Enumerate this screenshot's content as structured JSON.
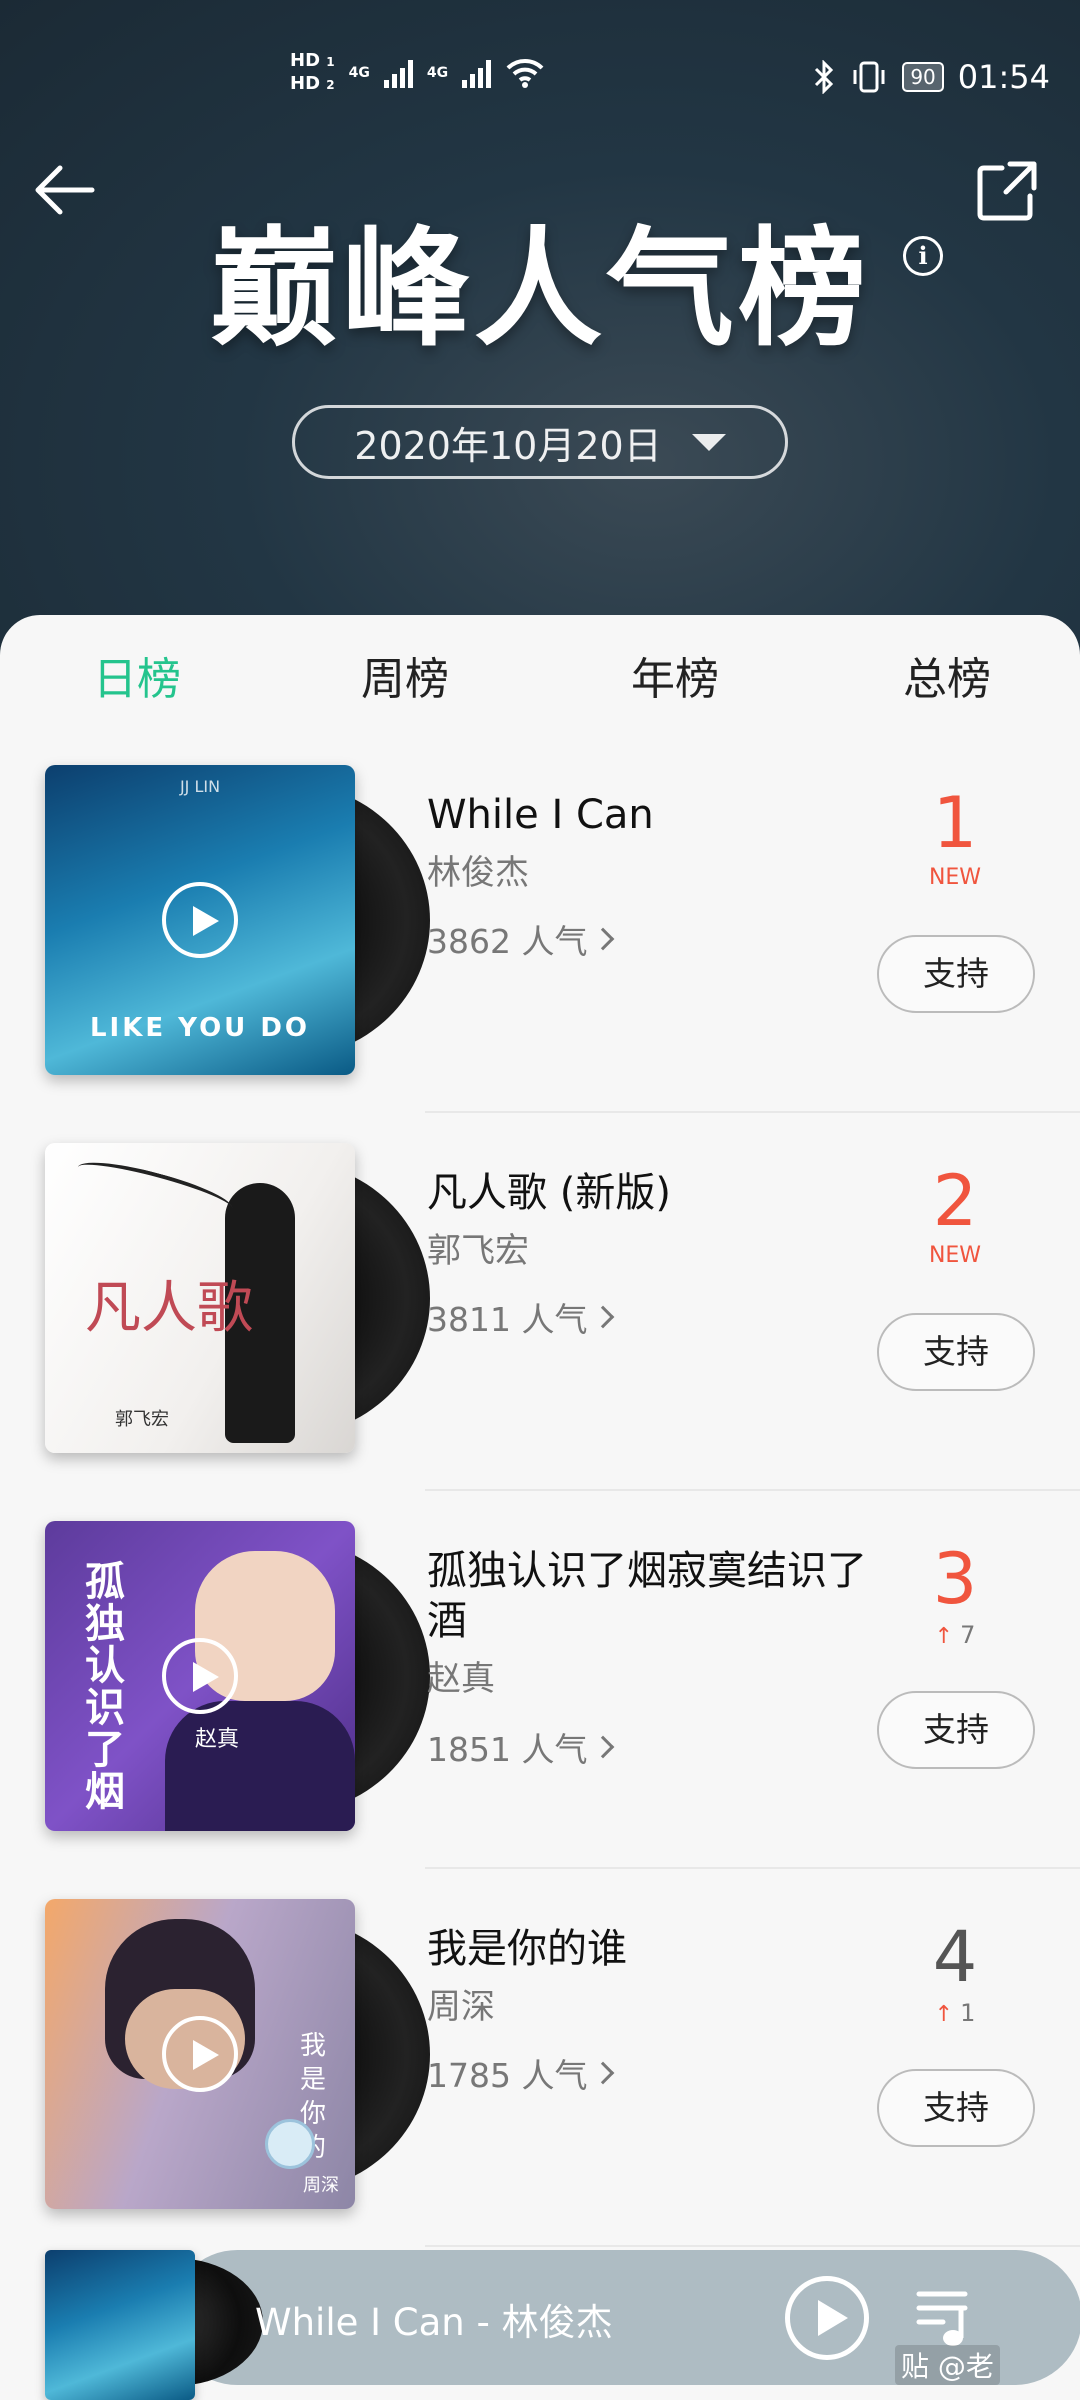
{
  "status_bar": {
    "hd1": "HD",
    "hd2": "HD",
    "sim1": "1",
    "sim2": "2",
    "net1": "4G",
    "net2": "4G",
    "battery": "90",
    "time": "01:54"
  },
  "header": {
    "title": "巅峰人气榜",
    "date": "2020年10月20日",
    "info_label": "i"
  },
  "tabs": [
    {
      "label": "日榜",
      "active": true
    },
    {
      "label": "周榜",
      "active": false
    },
    {
      "label": "年榜",
      "active": false
    },
    {
      "label": "总榜",
      "active": false
    }
  ],
  "songs": [
    {
      "title": "While I Can",
      "artist": "林俊杰",
      "popularity": "3862 人气",
      "rank": "1",
      "rank_sub": "NEW",
      "support": "支持",
      "cover_text": "LIKE YOU DO",
      "cover_top": "JJ LIN"
    },
    {
      "title": "凡人歌 (新版)",
      "artist": "郭飞宏",
      "popularity": "3811 人气",
      "rank": "2",
      "rank_sub": "NEW",
      "support": "支持",
      "cover_text": "凡人歌",
      "cover_top": "郭飞宏"
    },
    {
      "title": "孤独认识了烟寂寞结识了酒",
      "artist": "赵真",
      "popularity": "1851 人气",
      "rank": "3",
      "rank_change": "7",
      "support": "支持",
      "cover_text": "孤独认识了烟",
      "cover_top": "赵真"
    },
    {
      "title": "我是你的谁",
      "artist": "周深",
      "popularity": "1785 人气",
      "rank": "4",
      "rank_change": "1",
      "support": "支持",
      "cover_text": "我是你的",
      "cover_top": "周深"
    }
  ],
  "player": {
    "now_playing": "While I Can - 林俊杰"
  },
  "watermark": "贴 @老"
}
